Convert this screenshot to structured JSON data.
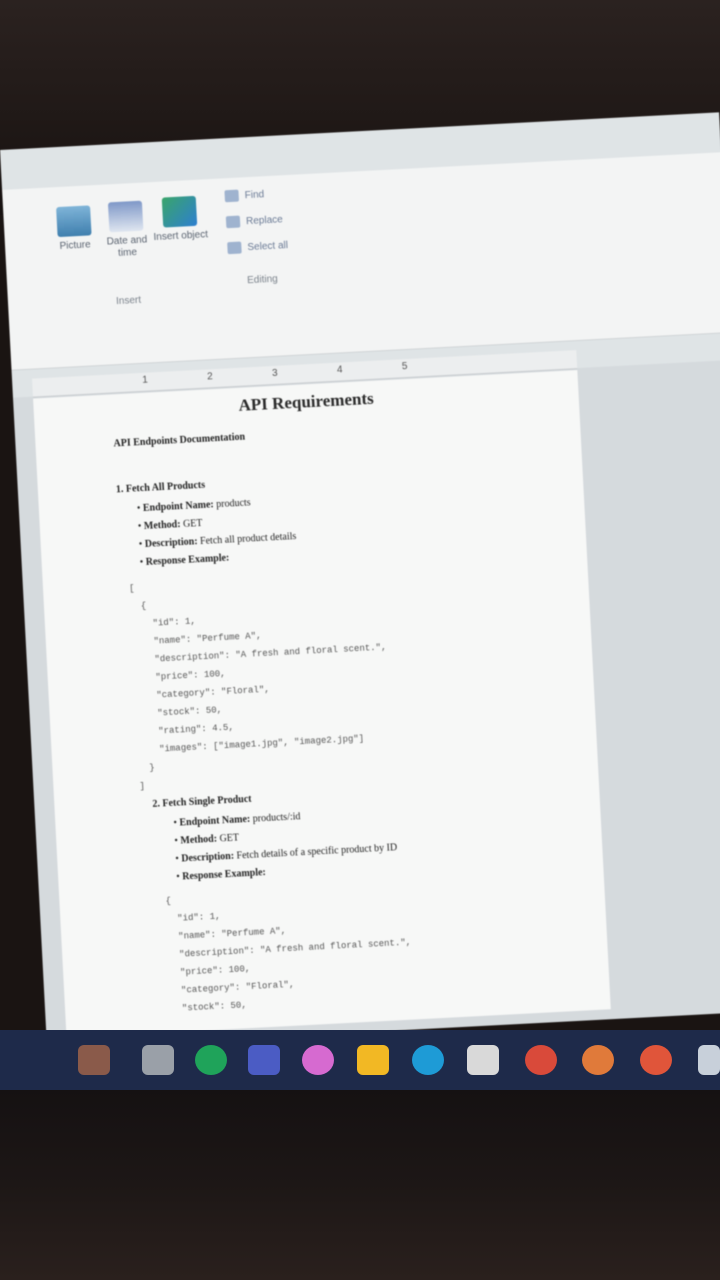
{
  "ribbon": {
    "insert_buttons": [
      {
        "label": "Picture",
        "icon": "picture-icon"
      },
      {
        "label": "Date and time",
        "icon": "calendar-icon"
      },
      {
        "label": "Insert object",
        "icon": "insert-object-icon"
      }
    ],
    "insert_group": "Insert",
    "editing_items": [
      {
        "label": "Find",
        "icon": "find-icon"
      },
      {
        "label": "Replace",
        "icon": "replace-icon"
      },
      {
        "label": "Select all",
        "icon": "select-all-icon"
      }
    ],
    "editing_group": "Editing"
  },
  "ruler": {
    "ticks": [
      "1",
      "2",
      "3",
      "4",
      "5"
    ]
  },
  "document": {
    "title": "API Requirements",
    "subtitle": "API Endpoints Documentation",
    "sections": [
      {
        "heading": "1. Fetch All Products",
        "bullets": [
          {
            "label": "Endpoint Name:",
            "value": "products"
          },
          {
            "label": "Method:",
            "value": "GET"
          },
          {
            "label": "Description:",
            "value": "Fetch all product details"
          },
          {
            "label": "Response Example:",
            "value": ""
          }
        ],
        "code": [
          "[",
          "  {",
          "    \"id\": 1,",
          "    \"name\": \"Perfume A\",",
          "    \"description\": \"A fresh and floral scent.\",",
          "    \"price\": 100,",
          "    \"category\": \"Floral\",",
          "    \"stock\": 50,",
          "    \"rating\": 4.5,",
          "    \"images\": [\"image1.jpg\", \"image2.jpg\"]",
          "  }",
          "]"
        ]
      },
      {
        "heading": "2. Fetch Single Product",
        "bullets": [
          {
            "label": "Endpoint Name:",
            "value": "products/:id"
          },
          {
            "label": "Method:",
            "value": "GET"
          },
          {
            "label": "Description:",
            "value": "Fetch details of a specific product by ID"
          },
          {
            "label": "Response Example:",
            "value": ""
          }
        ],
        "code": [
          "{",
          "  \"id\": 1,",
          "  \"name\": \"Perfume A\",",
          "  \"description\": \"A fresh and floral scent.\",",
          "  \"price\": 100,",
          "  \"category\": \"Floral\",",
          "  \"stock\": 50,"
        ]
      }
    ]
  },
  "taskbar": {
    "icons": [
      {
        "name": "photo-thumbnail-icon",
        "color": "#8a5a4a"
      },
      {
        "name": "file-icon",
        "color": "#9aa0a8"
      },
      {
        "name": "grammarly-icon",
        "color": "#1fa35a"
      },
      {
        "name": "teams-icon",
        "color": "#4b5cc4"
      },
      {
        "name": "copilot-icon",
        "color": "#d66ad0"
      },
      {
        "name": "file-explorer-icon",
        "color": "#f2b824"
      },
      {
        "name": "edge-icon",
        "color": "#1e9bd6"
      },
      {
        "name": "notepad-icon",
        "color": "#d9d9d9"
      },
      {
        "name": "chrome-icon",
        "color": "#d94a3a"
      },
      {
        "name": "chrome-profile-icon",
        "color": "#e07a3a"
      },
      {
        "name": "app-icon",
        "color": "#e0553a"
      },
      {
        "name": "overflow-icon",
        "color": "#c8d0da"
      }
    ]
  }
}
